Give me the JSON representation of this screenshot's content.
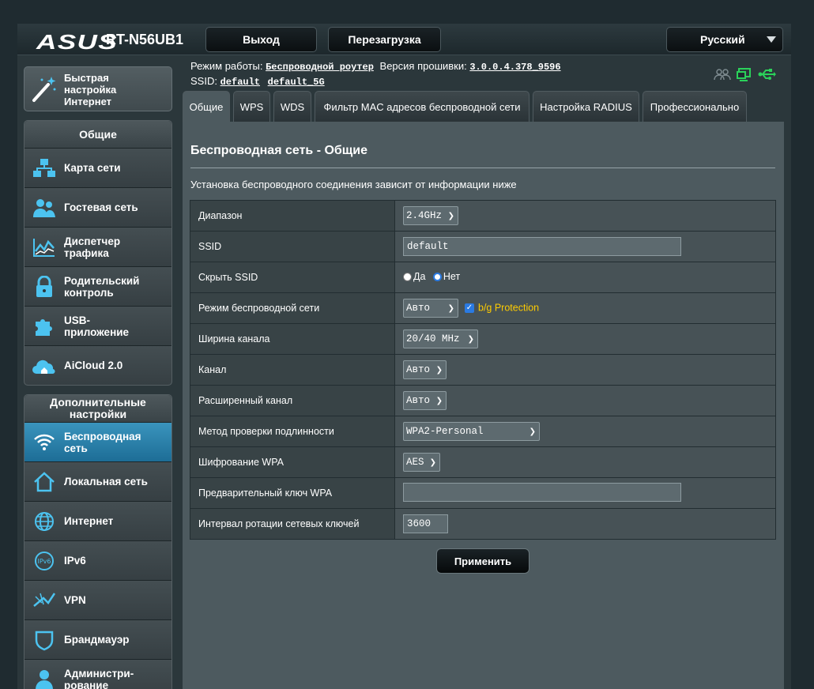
{
  "header": {
    "logo": "ASUS",
    "model": "RT-N56UB1",
    "logout_label": "Выход",
    "reboot_label": "Перезагрузка",
    "language": "Русский"
  },
  "info": {
    "mode_label": "Режим работы:",
    "mode_value": "Беспроводной роутер",
    "fw_label": "Версия прошивки:",
    "fw_value": "3.0.0.4.378_9596",
    "ssid_label": "SSID:",
    "ssid_1": "default",
    "ssid_2": "default_5G"
  },
  "sidebar": {
    "quick_setup_1": "Быстрая",
    "quick_setup_2": "настройка",
    "quick_setup_3": "Интернет",
    "general_header": "Общие",
    "general_items": [
      {
        "l1": "Карта сети",
        "l2": "",
        "icon": "network-map-icon"
      },
      {
        "l1": "Гостевая сеть",
        "l2": "",
        "icon": "guest-network-icon"
      },
      {
        "l1": "Диспетчер",
        "l2": "трафика",
        "icon": "traffic-manager-icon"
      },
      {
        "l1": "Родительский",
        "l2": "контроль",
        "icon": "lock-icon"
      },
      {
        "l1": "USB-",
        "l2": "приложение",
        "icon": "puzzle-icon"
      },
      {
        "l1": "AiCloud 2.0",
        "l2": "",
        "icon": "cloud-icon"
      }
    ],
    "advanced_header_1": "Дополнительные",
    "advanced_header_2": "настройки",
    "advanced_items": [
      {
        "l1": "Беспроводная",
        "l2": "сеть",
        "icon": "wifi-icon",
        "active": true
      },
      {
        "l1": "Локальная сеть",
        "l2": "",
        "icon": "home-icon"
      },
      {
        "l1": "Интернет",
        "l2": "",
        "icon": "globe-icon"
      },
      {
        "l1": "IPv6",
        "l2": "",
        "icon": "ipv6-icon"
      },
      {
        "l1": "VPN",
        "l2": "",
        "icon": "vpn-icon"
      },
      {
        "l1": "Брандмауэр",
        "l2": "",
        "icon": "shield-icon"
      },
      {
        "l1": "Администри-",
        "l2": "рование",
        "icon": "admin-user-icon"
      }
    ]
  },
  "tabs": [
    "Общие",
    "WPS",
    "WDS",
    "Фильтр MAC адресов беспроводной сети",
    "Настройка RADIUS",
    "Профессионально"
  ],
  "main": {
    "title": "Беспроводная сеть - Общие",
    "description": "Установка беспроводного соединения зависит от информации ниже",
    "rows": {
      "band_label": "Диапазон",
      "band_value": "2.4GHz",
      "ssid_label": "SSID",
      "ssid_value": "default",
      "hide_label": "Скрыть SSID",
      "hide_yes": "Да",
      "hide_no": "Нет",
      "mode_label": "Режим беспроводной сети",
      "mode_value": "Авто",
      "bg_protection": "b/g Protection",
      "width_label": "Ширина канала",
      "width_value": "20/40 MHz",
      "channel_label": "Канал",
      "channel_value": "Авто",
      "ext_channel_label": "Расширенный канал",
      "ext_channel_value": "Авто",
      "auth_label": "Метод проверки подлинности",
      "auth_value": "WPA2-Personal",
      "enc_label": "Шифрование WPA",
      "enc_value": "AES",
      "psk_label": "Предварительный ключ WPA",
      "psk_value": "",
      "interval_label": "Интервал ротации сетевых ключей",
      "interval_value": "3600"
    },
    "apply_label": "Применить"
  },
  "colors": {
    "accent_blue": "#2a85b3",
    "bg_protection_text": "#ffcc00",
    "usb_icon": "#2bd15a"
  }
}
